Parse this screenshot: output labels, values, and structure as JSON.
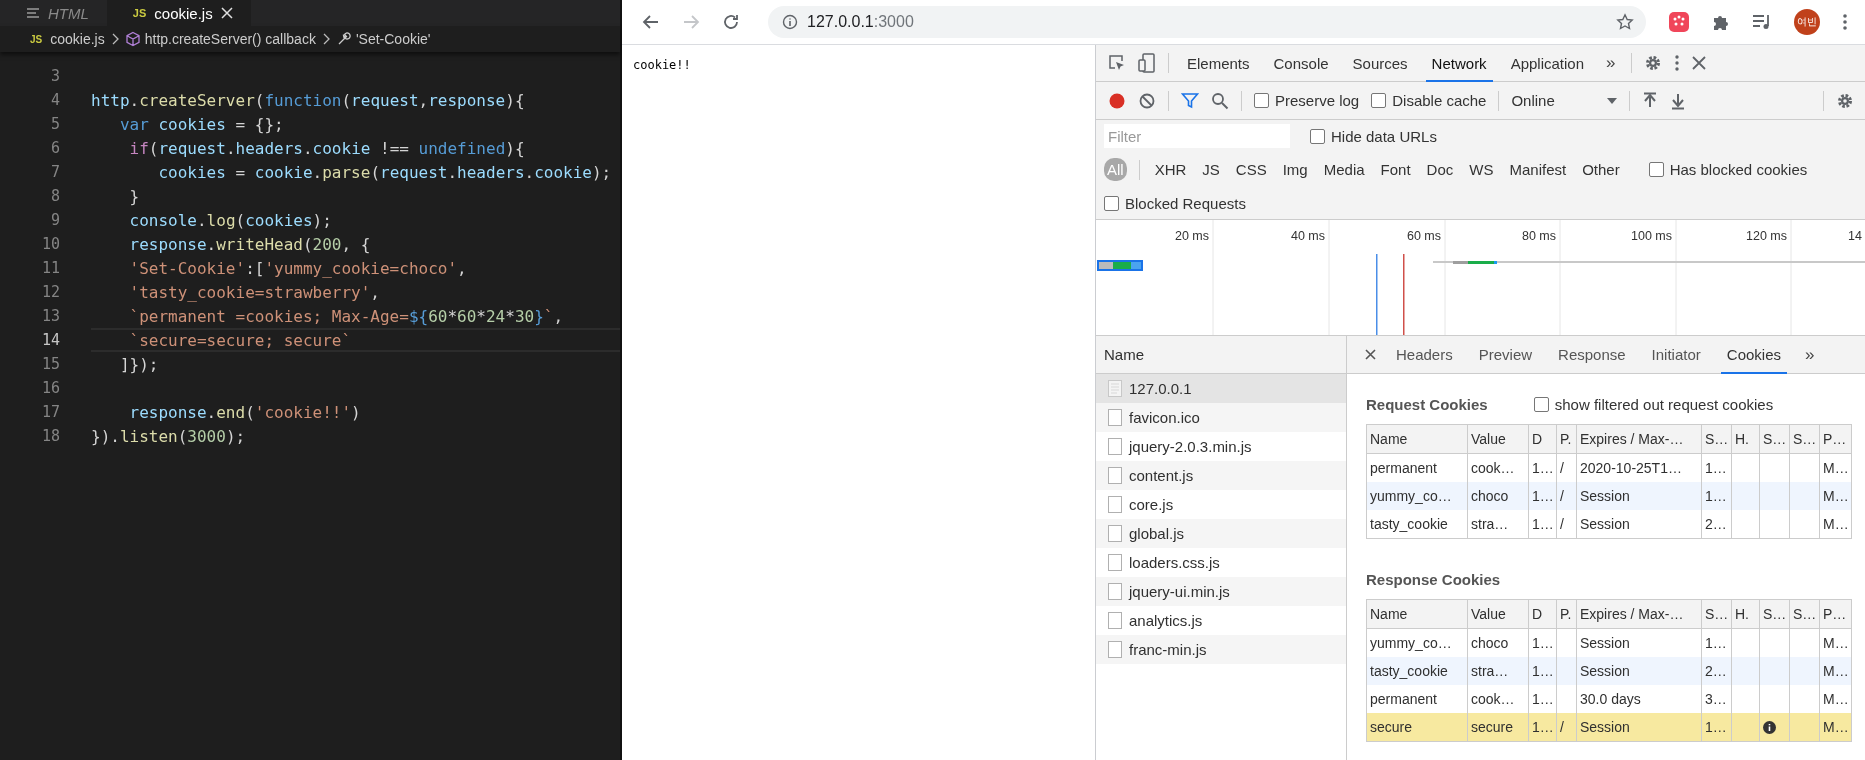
{
  "editor": {
    "tabs": [
      {
        "label": "HTML",
        "kind": "html",
        "selected": false
      },
      {
        "label": "cookie.js",
        "kind": "js",
        "badge": "JS",
        "selected": true
      }
    ],
    "breadcrumb": [
      {
        "label": "cookie.js",
        "kind": "file",
        "badge": "JS"
      },
      {
        "label": "http.createServer() callback",
        "kind": "function"
      },
      {
        "label": "'Set-Cookie'",
        "kind": "property"
      }
    ],
    "lines": [
      {
        "number": "3",
        "current": false
      },
      {
        "number": "4",
        "current": false,
        "tokens": [
          {
            "text": "http",
            "kind": "variable"
          },
          {
            "text": ".",
            "kind": "punct"
          },
          {
            "text": "createServer",
            "kind": "function"
          },
          {
            "text": "(",
            "kind": "punct"
          },
          {
            "text": "function",
            "kind": "keyword"
          },
          {
            "text": "(",
            "kind": "punct"
          },
          {
            "text": "request",
            "kind": "variable"
          },
          {
            "text": ",",
            "kind": "punct"
          },
          {
            "text": "response",
            "kind": "variable"
          },
          {
            "text": "){",
            "kind": "punct"
          }
        ]
      },
      {
        "number": "5",
        "current": false,
        "tokens": [
          {
            "text": "   var",
            "kind": "keyword"
          },
          {
            "text": " cookies",
            "kind": "variable"
          },
          {
            "text": " = {};",
            "kind": "punct"
          }
        ]
      },
      {
        "number": "6",
        "current": false,
        "tokens": [
          {
            "text": "    if",
            "kind": "control"
          },
          {
            "text": "(",
            "kind": "punct"
          },
          {
            "text": "request",
            "kind": "variable"
          },
          {
            "text": ".",
            "kind": "punct"
          },
          {
            "text": "headers",
            "kind": "variable"
          },
          {
            "text": ".",
            "kind": "punct"
          },
          {
            "text": "cookie",
            "kind": "variable"
          },
          {
            "text": " !== ",
            "kind": "punct"
          },
          {
            "text": "undefined",
            "kind": "keyword"
          },
          {
            "text": "){",
            "kind": "punct"
          }
        ]
      },
      {
        "number": "7",
        "current": false,
        "tokens": [
          {
            "text": "       cookies",
            "kind": "variable"
          },
          {
            "text": " = ",
            "kind": "punct"
          },
          {
            "text": "cookie",
            "kind": "variable"
          },
          {
            "text": ".",
            "kind": "punct"
          },
          {
            "text": "parse",
            "kind": "function"
          },
          {
            "text": "(",
            "kind": "punct"
          },
          {
            "text": "request",
            "kind": "variable"
          },
          {
            "text": ".",
            "kind": "punct"
          },
          {
            "text": "headers",
            "kind": "variable"
          },
          {
            "text": ".",
            "kind": "punct"
          },
          {
            "text": "cookie",
            "kind": "variable"
          },
          {
            "text": ");",
            "kind": "punct"
          }
        ]
      },
      {
        "number": "8",
        "current": false,
        "tokens": [
          {
            "text": "    }",
            "kind": "punct"
          }
        ]
      },
      {
        "number": "9",
        "current": false,
        "tokens": [
          {
            "text": "    console",
            "kind": "variable"
          },
          {
            "text": ".",
            "kind": "punct"
          },
          {
            "text": "log",
            "kind": "function"
          },
          {
            "text": "(",
            "kind": "punct"
          },
          {
            "text": "cookies",
            "kind": "variable"
          },
          {
            "text": ");",
            "kind": "punct"
          }
        ]
      },
      {
        "number": "10",
        "current": false,
        "tokens": [
          {
            "text": "    response",
            "kind": "variable"
          },
          {
            "text": ".",
            "kind": "punct"
          },
          {
            "text": "writeHead",
            "kind": "function"
          },
          {
            "text": "(",
            "kind": "punct"
          },
          {
            "text": "200",
            "kind": "number"
          },
          {
            "text": ", {",
            "kind": "punct"
          }
        ]
      },
      {
        "number": "11",
        "current": false,
        "tokens": [
          {
            "text": "    'Set-Cookie'",
            "kind": "string"
          },
          {
            "text": ":[",
            "kind": "punct"
          },
          {
            "text": "'yummy_cookie=choco'",
            "kind": "string"
          },
          {
            "text": ",",
            "kind": "punct"
          }
        ]
      },
      {
        "number": "12",
        "current": false,
        "tokens": [
          {
            "text": "    'tasty_cookie=strawberry'",
            "kind": "string"
          },
          {
            "text": ",",
            "kind": "punct"
          }
        ]
      },
      {
        "number": "13",
        "current": false,
        "tokens": [
          {
            "text": "    `permanent =cookies; Max-Age=",
            "kind": "string"
          },
          {
            "text": "${",
            "kind": "keyword"
          },
          {
            "text": "60",
            "kind": "number"
          },
          {
            "text": "*",
            "kind": "punct"
          },
          {
            "text": "60",
            "kind": "number"
          },
          {
            "text": "*",
            "kind": "punct"
          },
          {
            "text": "24",
            "kind": "number"
          },
          {
            "text": "*",
            "kind": "punct"
          },
          {
            "text": "30",
            "kind": "number"
          },
          {
            "text": "}",
            "kind": "keyword"
          },
          {
            "text": "`",
            "kind": "string"
          },
          {
            "text": ",",
            "kind": "punct"
          }
        ]
      },
      {
        "number": "14",
        "current": true,
        "tokens": [
          {
            "text": "    `secure=secure; secure`",
            "kind": "string"
          }
        ]
      },
      {
        "number": "15",
        "current": false,
        "tokens": [
          {
            "text": "   ]});",
            "kind": "punct"
          }
        ]
      },
      {
        "number": "16",
        "current": false
      },
      {
        "number": "17",
        "current": false,
        "tokens": [
          {
            "text": "    response",
            "kind": "variable"
          },
          {
            "text": ".",
            "kind": "punct"
          },
          {
            "text": "end",
            "kind": "function"
          },
          {
            "text": "(",
            "kind": "punct"
          },
          {
            "text": "'cookie!!'",
            "kind": "string"
          },
          {
            "text": ")",
            "kind": "punct"
          }
        ]
      },
      {
        "number": "18",
        "current": false,
        "tokens": [
          {
            "text": "}).",
            "kind": "punct"
          },
          {
            "text": "listen",
            "kind": "function"
          },
          {
            "text": "(",
            "kind": "punct"
          },
          {
            "text": "3000",
            "kind": "number"
          },
          {
            "text": ");",
            "kind": "punct"
          }
        ]
      }
    ]
  },
  "browser": {
    "forward_disabled": true,
    "url_host": "127.0.0.1",
    "url_port": ":3000",
    "avatar": "여빈"
  },
  "page": {
    "text": "cookie!!"
  },
  "devtools": {
    "tabs": [
      {
        "label": "Elements",
        "selected": false
      },
      {
        "label": "Console",
        "selected": false
      },
      {
        "label": "Sources",
        "selected": false
      },
      {
        "label": "Network",
        "selected": true
      },
      {
        "label": "Application",
        "selected": false
      }
    ],
    "more": "»",
    "network_toolbar": {
      "recording": true,
      "filter_active": true,
      "checkboxes": [
        {
          "label": "Preserve log",
          "checked": false
        },
        {
          "label": "Disable cache",
          "checked": false
        }
      ],
      "throttle": "Online"
    },
    "filter": {
      "placeholder": "Filter",
      "hide_data_urls": {
        "label": "Hide data URLs",
        "checked": false
      }
    },
    "types": [
      {
        "label": "All",
        "selected": true
      },
      {
        "label": "XHR",
        "selected": false
      },
      {
        "label": "JS",
        "selected": false
      },
      {
        "label": "CSS",
        "selected": false
      },
      {
        "label": "Img",
        "selected": false
      },
      {
        "label": "Media",
        "selected": false
      },
      {
        "label": "Font",
        "selected": false
      },
      {
        "label": "Doc",
        "selected": false
      },
      {
        "label": "WS",
        "selected": false
      },
      {
        "label": "Manifest",
        "selected": false
      },
      {
        "label": "Other",
        "selected": false
      }
    ],
    "has_blocked_cookies": {
      "label": "Has blocked cookies",
      "checked": false
    },
    "blocked_requests": {
      "label": "Blocked Requests",
      "checked": false
    },
    "timeline": {
      "ticks": [
        "20 ms",
        "40 ms",
        "60 ms",
        "80 ms",
        "100 ms",
        "120 ms",
        "14"
      ]
    },
    "requests": {
      "header": "Name",
      "items": [
        {
          "name": "127.0.0.1",
          "kind": "document",
          "selected": true
        },
        {
          "name": "favicon.ico",
          "kind": "file",
          "selected": false
        },
        {
          "name": "jquery-2.0.3.min.js",
          "kind": "file",
          "selected": false
        },
        {
          "name": "content.js",
          "kind": "file",
          "selected": false
        },
        {
          "name": "core.js",
          "kind": "file",
          "selected": false
        },
        {
          "name": "global.js",
          "kind": "file",
          "selected": false
        },
        {
          "name": "loaders.css.js",
          "kind": "file",
          "selected": false
        },
        {
          "name": "jquery-ui.min.js",
          "kind": "file",
          "selected": false
        },
        {
          "name": "analytics.js",
          "kind": "file",
          "selected": false
        },
        {
          "name": "franc-min.js",
          "kind": "file",
          "selected": false
        }
      ]
    },
    "details": {
      "tabs": [
        {
          "label": "Headers",
          "selected": false
        },
        {
          "label": "Preview",
          "selected": false
        },
        {
          "label": "Response",
          "selected": false
        },
        {
          "label": "Initiator",
          "selected": false
        },
        {
          "label": "Cookies",
          "selected": true
        }
      ],
      "more": "»",
      "request_cookies": {
        "title": "Request Cookies",
        "show_filtered": {
          "label": "show filtered out request cookies",
          "checked": false
        },
        "columns": [
          "Name",
          "Value",
          "D",
          "P.",
          "Expires / Max-…",
          "S…",
          "H.",
          "S…",
          "S…",
          "P…"
        ],
        "rows": [
          {
            "cells": [
              "permanent",
              "cook…",
              "1…",
              "/",
              "2020-10-25T1…",
              "1…",
              null,
              null,
              null,
              "M…"
            ],
            "flagged": false
          },
          {
            "cells": [
              "yummy_co…",
              "choco",
              "1…",
              "/",
              "Session",
              "1…",
              null,
              null,
              null,
              "M…"
            ],
            "flagged": false
          },
          {
            "cells": [
              "tasty_cookie",
              "stra…",
              "1…",
              "/",
              "Session",
              "2…",
              null,
              null,
              null,
              "M…"
            ],
            "flagged": false
          }
        ]
      },
      "response_cookies": {
        "title": "Response Cookies",
        "columns": [
          "Name",
          "Value",
          "D",
          "P.",
          "Expires / Max-…",
          "S…",
          "H.",
          "S…",
          "S…",
          "P…"
        ],
        "rows": [
          {
            "cells": [
              "yummy_co…",
              "choco",
              "1…",
              null,
              "Session",
              "1…",
              null,
              null,
              null,
              "M…"
            ],
            "flagged": false
          },
          {
            "cells": [
              "tasty_cookie",
              "stra…",
              "1…",
              null,
              "Session",
              "2…",
              null,
              null,
              null,
              "M…"
            ],
            "flagged": false
          },
          {
            "cells": [
              "permanent",
              "cook…",
              "1…",
              null,
              "30.0 days",
              "3…",
              null,
              null,
              null,
              "M…"
            ],
            "flagged": false
          },
          {
            "cells": [
              "secure",
              "secure",
              "1…",
              "/",
              "Session",
              "1…",
              null,
              null,
              null,
              "M…"
            ],
            "flagged": true
          }
        ]
      }
    }
  }
}
